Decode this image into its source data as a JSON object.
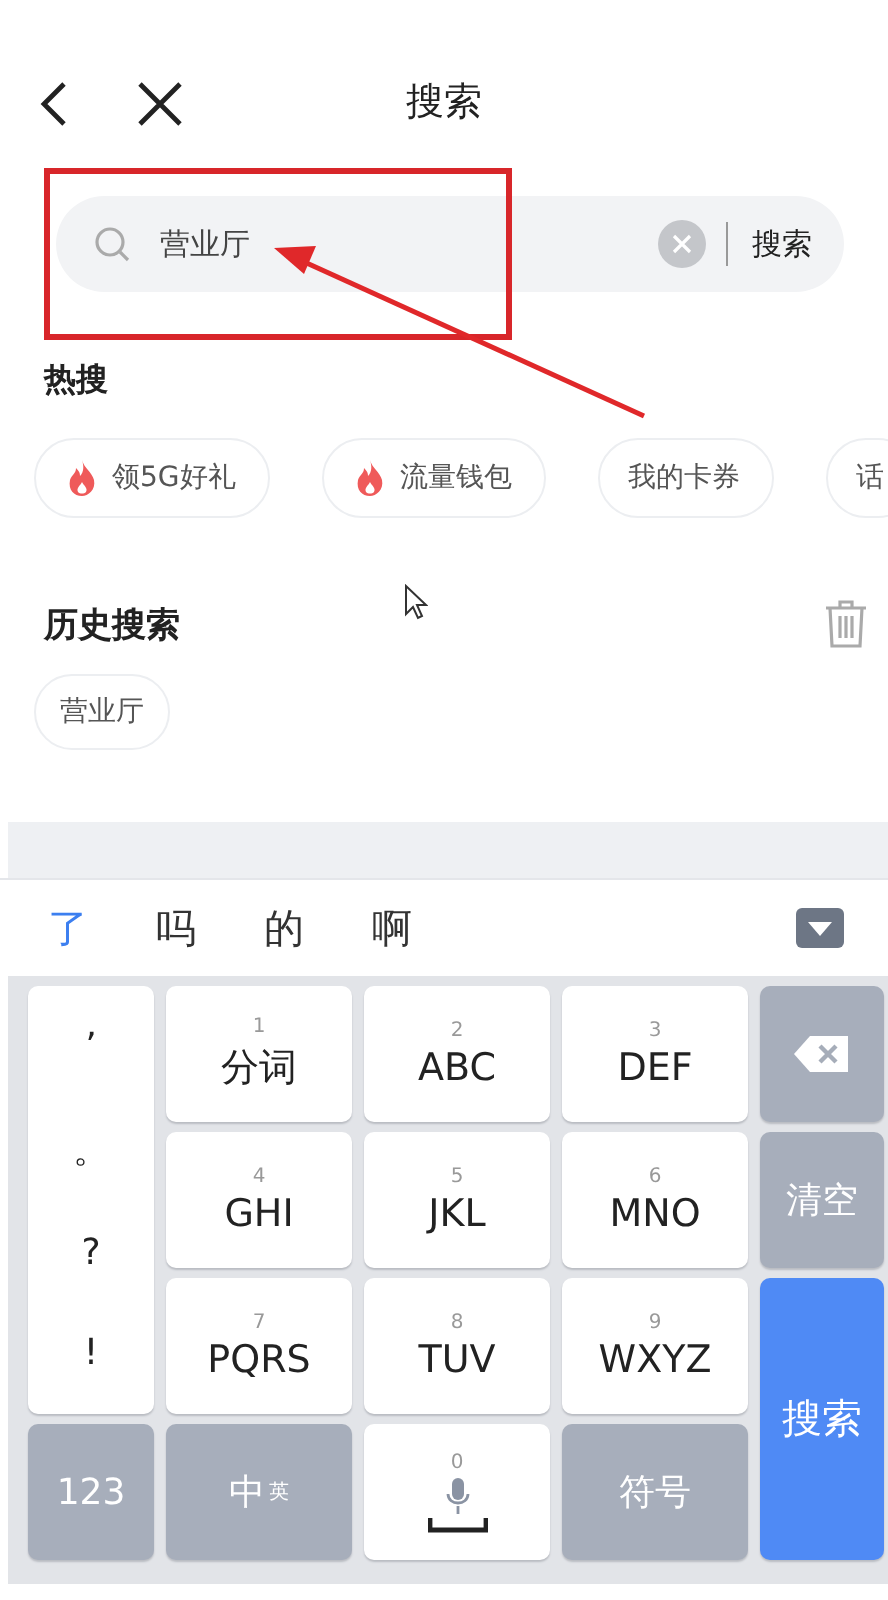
{
  "header": {
    "title": "搜索"
  },
  "search": {
    "value": "营业厅",
    "button": "搜索"
  },
  "hot": {
    "title": "热搜",
    "items": [
      {
        "label": "领5G好礼",
        "hot": true
      },
      {
        "label": "流量钱包",
        "hot": true
      },
      {
        "label": "我的卡券",
        "hot": false
      },
      {
        "label": "话",
        "hot": false
      }
    ]
  },
  "history": {
    "title": "历史搜索",
    "items": [
      "营业厅"
    ]
  },
  "keyboard": {
    "candidates": [
      {
        "text": "了",
        "selected": true
      },
      {
        "text": "吗",
        "selected": false
      },
      {
        "text": "的",
        "selected": false
      },
      {
        "text": "啊",
        "selected": false
      }
    ],
    "punctuation": [
      "’",
      "。",
      "?",
      "!"
    ],
    "keys": [
      {
        "digit": "1",
        "label": "分词"
      },
      {
        "digit": "2",
        "label": "ABC"
      },
      {
        "digit": "3",
        "label": "DEF"
      },
      {
        "digit": "4",
        "label": "GHI"
      },
      {
        "digit": "5",
        "label": "JKL"
      },
      {
        "digit": "6",
        "label": "MNO"
      },
      {
        "digit": "7",
        "label": "PQRS"
      },
      {
        "digit": "8",
        "label": "TUV"
      },
      {
        "digit": "9",
        "label": "WXYZ"
      }
    ],
    "side_keys": [
      {
        "kind": "backspace"
      },
      {
        "kind": "function",
        "label": "清空"
      },
      {
        "kind": "primary",
        "label": "搜索"
      }
    ],
    "bottom_keys": [
      {
        "kind": "function",
        "label": "123"
      },
      {
        "kind": "language",
        "label": "中",
        "sub": "英"
      },
      {
        "kind": "space",
        "digit": "0"
      },
      {
        "kind": "function",
        "label": "符号"
      }
    ]
  }
}
